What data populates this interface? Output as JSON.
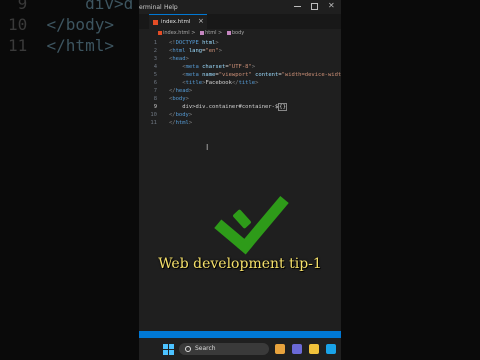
{
  "background": {
    "left_lines": [
      {
        "num": "9",
        "code": "    div>d"
      },
      {
        "num": "10",
        "code": "</body>"
      },
      {
        "num": "11",
        "code": "</html>"
      }
    ]
  },
  "menubar": {
    "items": [
      "erminal",
      "Help"
    ]
  },
  "tab": {
    "label": "index.html",
    "close": "×"
  },
  "breadcrumb": {
    "file": "index.html",
    "sep1": ">",
    "item1": "html",
    "sep2": ">",
    "item2": "body"
  },
  "editor": {
    "lines": [
      {
        "num": "1",
        "parts": [
          [
            "t-punct",
            "<!"
          ],
          [
            "t-tag",
            "DOCTYPE"
          ],
          [
            "t-txt",
            " "
          ],
          [
            "t-attr",
            "html"
          ],
          [
            "t-punct",
            ">"
          ]
        ]
      },
      {
        "num": "2",
        "parts": [
          [
            "t-punct",
            "<"
          ],
          [
            "t-tag",
            "html"
          ],
          [
            "t-txt",
            " "
          ],
          [
            "t-attr",
            "lang"
          ],
          [
            "t-txt",
            "="
          ],
          [
            "t-str",
            "\"en\""
          ],
          [
            "t-punct",
            ">"
          ]
        ]
      },
      {
        "num": "3",
        "parts": [
          [
            "t-punct",
            "<"
          ],
          [
            "t-tag",
            "head"
          ],
          [
            "t-punct",
            ">"
          ]
        ]
      },
      {
        "num": "4",
        "parts": [
          [
            "t-txt",
            "    "
          ],
          [
            "t-punct",
            "<"
          ],
          [
            "t-tag",
            "meta"
          ],
          [
            "t-txt",
            " "
          ],
          [
            "t-attr",
            "charset"
          ],
          [
            "t-txt",
            "="
          ],
          [
            "t-str",
            "\"UTF-8\""
          ],
          [
            "t-punct",
            ">"
          ]
        ]
      },
      {
        "num": "5",
        "parts": [
          [
            "t-txt",
            "    "
          ],
          [
            "t-punct",
            "<"
          ],
          [
            "t-tag",
            "meta"
          ],
          [
            "t-txt",
            " "
          ],
          [
            "t-attr",
            "name"
          ],
          [
            "t-txt",
            "="
          ],
          [
            "t-str",
            "\"viewport\""
          ],
          [
            "t-txt",
            " "
          ],
          [
            "t-attr",
            "content"
          ],
          [
            "t-txt",
            "="
          ],
          [
            "t-str",
            "\"width=device-width,"
          ]
        ]
      },
      {
        "num": "6",
        "parts": [
          [
            "t-txt",
            "    "
          ],
          [
            "t-punct",
            "<"
          ],
          [
            "t-tag",
            "title"
          ],
          [
            "t-punct",
            ">"
          ],
          [
            "t-txt",
            "Facebook"
          ],
          [
            "t-punct",
            "</"
          ],
          [
            "t-tag",
            "title"
          ],
          [
            "t-punct",
            ">"
          ]
        ]
      },
      {
        "num": "7",
        "parts": [
          [
            "t-punct",
            "</"
          ],
          [
            "t-tag",
            "head"
          ],
          [
            "t-punct",
            ">"
          ]
        ]
      },
      {
        "num": "8",
        "parts": [
          [
            "t-punct",
            "<"
          ],
          [
            "t-tag",
            "body"
          ],
          [
            "t-punct",
            ">"
          ]
        ]
      },
      {
        "num": "9",
        "active": true,
        "parts": [
          [
            "t-txt",
            "    div>div.container#container-$"
          ],
          [
            "cursor-box",
            "{}"
          ]
        ]
      },
      {
        "num": "10",
        "parts": [
          [
            "t-punct",
            "</"
          ],
          [
            "t-tag",
            "body"
          ],
          [
            "t-punct",
            ">"
          ]
        ]
      },
      {
        "num": "11",
        "parts": [
          [
            "t-punct",
            "</"
          ],
          [
            "t-tag",
            "html"
          ],
          [
            "t-punct",
            ">"
          ]
        ]
      }
    ]
  },
  "overlay": {
    "caption": "Web development tip-1",
    "check_color": "#2e9b19",
    "caption_color": "#f5e06a"
  },
  "taskbar": {
    "search_label": "Search",
    "icons": [
      {
        "name": "widgets-icon",
        "color": "#e8a33d"
      },
      {
        "name": "chat-icon",
        "color": "#6b69d6"
      },
      {
        "name": "file-explorer-icon",
        "color": "#f0c23b"
      },
      {
        "name": "edge-icon",
        "color": "#1aa3e8"
      }
    ]
  }
}
